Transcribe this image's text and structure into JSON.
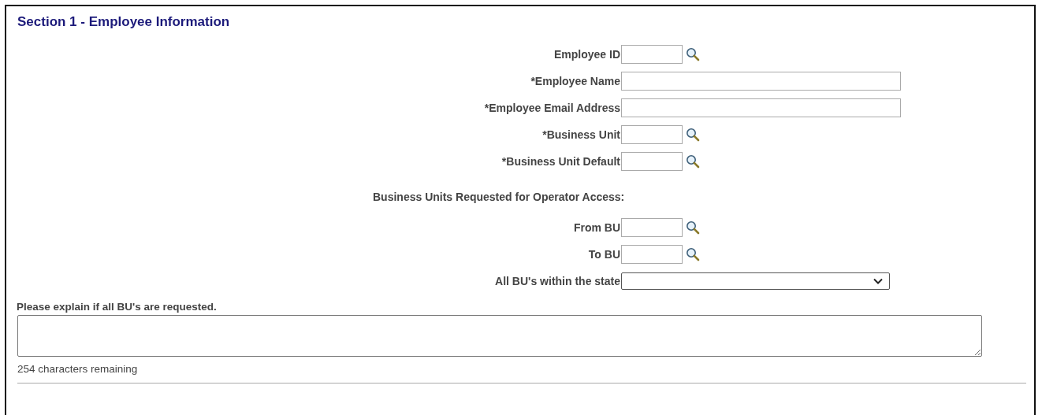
{
  "section": {
    "title": "Section 1 - Employee Information"
  },
  "fields": [
    {
      "kind": "lookup",
      "label": "Employee ID"
    },
    {
      "kind": "text",
      "label": "*Employee Name"
    },
    {
      "kind": "text",
      "label": "*Employee Email Address"
    },
    {
      "kind": "lookup",
      "label": "*Business Unit"
    },
    {
      "kind": "lookup",
      "label": "*Business Unit Default"
    },
    {
      "kind": "heading",
      "label": "Business Units Requested for Operator Access:"
    },
    {
      "kind": "lookup",
      "label": "From BU"
    },
    {
      "kind": "lookup",
      "label": "To BU"
    },
    {
      "kind": "select",
      "label": "All BU's within the state"
    }
  ],
  "explanation": {
    "label": "Please explain if all BU's are requested.",
    "counter": "254 characters remaining"
  }
}
